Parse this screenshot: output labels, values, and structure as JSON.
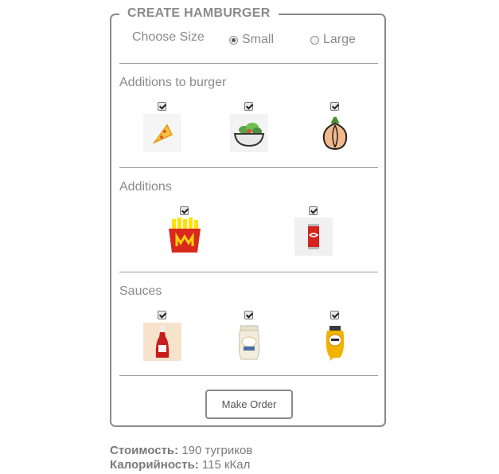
{
  "form": {
    "legend": "CREATE HAMBURGER",
    "size_label": "Choose Size",
    "size_options": [
      {
        "label": "Small",
        "checked": true
      },
      {
        "label": "Large",
        "checked": false
      }
    ],
    "sections": [
      {
        "title": "Additions to burger",
        "items": [
          {
            "icon": "pizza-slice-icon",
            "checked": true
          },
          {
            "icon": "salad-bowl-icon",
            "checked": true
          },
          {
            "icon": "onion-icon",
            "checked": true
          }
        ]
      },
      {
        "title": "Additions",
        "items": [
          {
            "icon": "french-fries-icon",
            "checked": true
          },
          {
            "icon": "cola-can-icon",
            "checked": true
          }
        ]
      },
      {
        "title": "Sauces",
        "items": [
          {
            "icon": "ketchup-bottle-icon",
            "checked": true
          },
          {
            "icon": "mayonnaise-jar-icon",
            "checked": true
          },
          {
            "icon": "mustard-bottle-icon",
            "checked": true
          }
        ]
      }
    ],
    "order_button": "Make Order"
  },
  "summary": {
    "cost_label": "Стоимость:",
    "cost_value": "190 тугриков",
    "calories_label": "Калорийность:",
    "calories_value": "115 кКал"
  }
}
